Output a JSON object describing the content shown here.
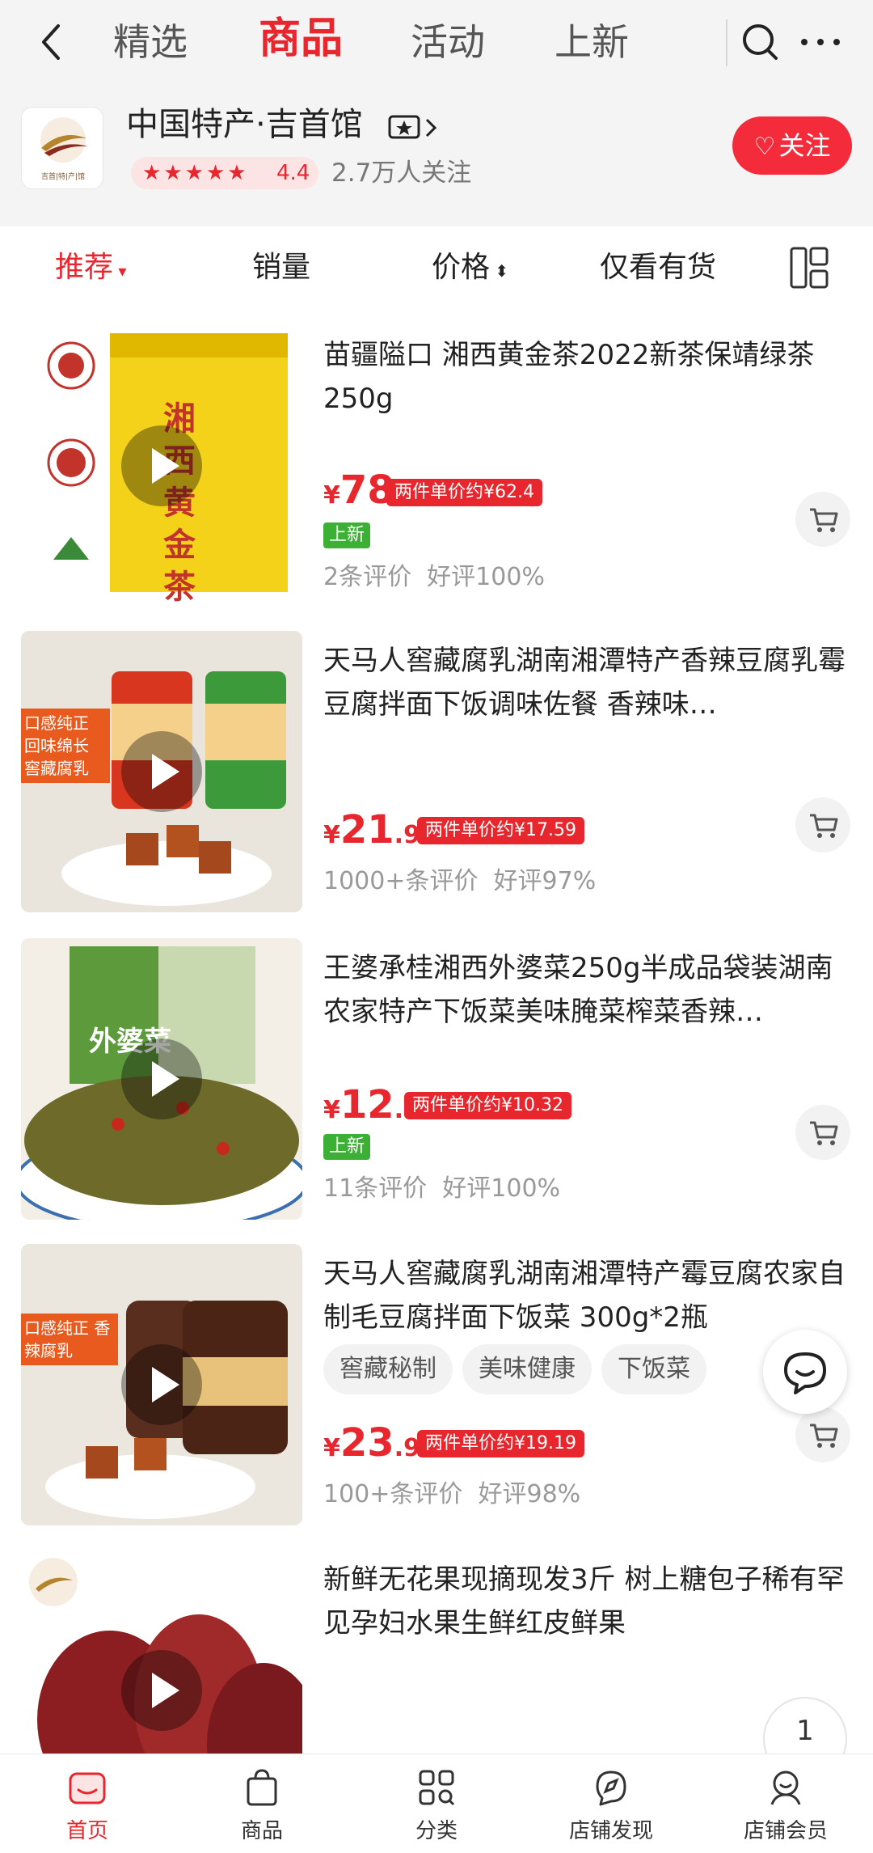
{
  "top_tabs": [
    "精选",
    "商品",
    "活动",
    "上新"
  ],
  "shop": {
    "name": "中国特产·吉首馆",
    "rating": "4.4",
    "followers": "2.7万人关注",
    "follow_label": "关注",
    "logo_text": "吉首|特|产|馆"
  },
  "filters": [
    "推荐",
    "销量",
    "价格",
    "仅看有货"
  ],
  "products": [
    {
      "title": "苗疆隘口 湘西黄金茶2022新茶保靖绿茶250g",
      "price_int": "78",
      "price_dec": "",
      "badge": "两件单价约¥62.4",
      "new_tag": "上新",
      "reviews": "2条评价",
      "good_rate": "好评100%",
      "image_text": "湘西黄金茶"
    },
    {
      "title": "天马人窖藏腐乳湖南湘潭特产香辣豆腐乳霉豆腐拌面下饭调味佐餐 香辣味…",
      "price_int": "21",
      "price_dec": ".98",
      "badge": "两件单价约¥17.59",
      "reviews": "1000+条评价",
      "good_rate": "好评97%",
      "image_text": "口感纯正 回味绵长 窖藏腐乳"
    },
    {
      "title": "王婆承桂湘西外婆菜250g半成品袋装湖南农家特产下饭菜美味腌菜榨菜香辣…",
      "price_int": "12",
      "price_dec": ".9",
      "badge": "两件单价约¥10.32",
      "new_tag": "上新",
      "reviews": "11条评价",
      "good_rate": "好评100%",
      "image_text": "外婆菜"
    },
    {
      "title": "天马人窖藏腐乳湖南湘潭特产霉豆腐农家自制毛豆腐拌面下饭菜 300g*2瓶",
      "chips": [
        "窖藏秘制",
        "美味健康",
        "下饭菜"
      ],
      "price_int": "23",
      "price_dec": ".98",
      "badge": "两件单价约¥19.19",
      "reviews": "100+条评价",
      "good_rate": "好评98%",
      "image_text": "口感纯正 香辣腐乳"
    },
    {
      "title": "新鲜无花果现摘现发3斤 树上糖包子稀有罕见孕妇水果生鲜红皮鲜果",
      "price_int": "",
      "price_dec": "",
      "reviews": "",
      "good_rate": ""
    }
  ],
  "currency": "¥",
  "page_indicator": "1",
  "bottom_nav": [
    "首页",
    "商品",
    "分类",
    "店铺发现",
    "店铺会员"
  ],
  "colors": {
    "accent": "#e8262d",
    "new_tag": "#3cb034",
    "follow": "#f42b3b"
  },
  "icons": [
    "back-arrow-icon",
    "search-icon",
    "more-icon",
    "layout-toggle-icon",
    "cart-icon",
    "play-icon",
    "chat-icon",
    "home-icon",
    "bag-icon",
    "category-icon",
    "discover-icon",
    "member-icon"
  ]
}
